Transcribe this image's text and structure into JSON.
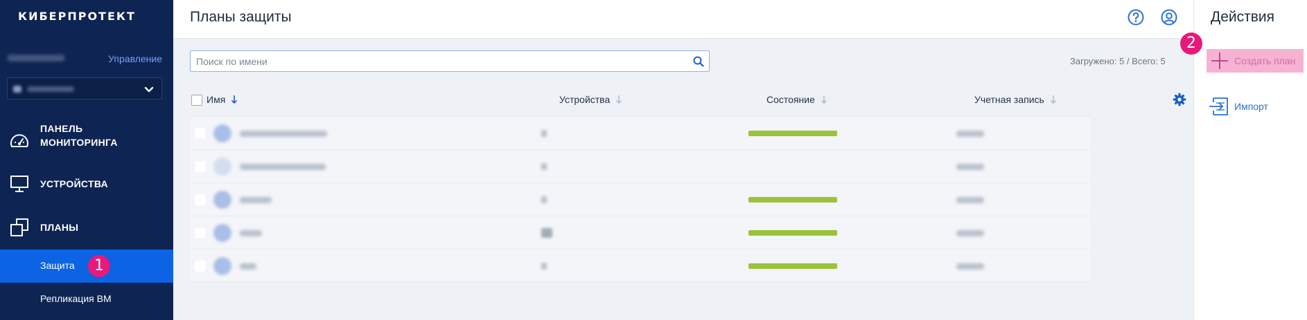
{
  "app": {
    "logo": "КИБЕРПРОТЕКТ"
  },
  "sidebar": {
    "manage_label": "Управление",
    "nav": [
      {
        "label": "ПАНЕЛЬ МОНИТОРИНГА",
        "icon": "dashboard-gauge-icon"
      },
      {
        "label": "УСТРОЙСТВА",
        "icon": "monitor-icon"
      },
      {
        "label": "ПЛАНЫ",
        "icon": "plans-stack-icon"
      }
    ],
    "sub": [
      {
        "label": "Защита",
        "active": true
      },
      {
        "label": "Репликация ВМ",
        "active": false
      }
    ],
    "badge_1": "1"
  },
  "header": {
    "title": "Планы защиты",
    "help_icon": "help-icon",
    "account_icon": "account-icon"
  },
  "search": {
    "placeholder": "Поиск по имени",
    "value": ""
  },
  "loaded_text": "Загружено: 5 / Всего: 5",
  "table": {
    "columns": [
      "Имя",
      "Устройства",
      "Состояние",
      "Учетная запись"
    ],
    "rows": [
      {
        "state": "ok"
      },
      {
        "state": "none"
      },
      {
        "state": "ok"
      },
      {
        "state": "ok"
      },
      {
        "state": "ok"
      }
    ]
  },
  "actions": {
    "title": "Действия",
    "create_label": "Создать план",
    "import_label": "Импорт",
    "badge_2": "2"
  },
  "colors": {
    "sidebar_bg": "#0e2452",
    "accent": "#0c63e4",
    "badge": "#e8197a",
    "status_ok": "#9bc23b",
    "create_highlight": "#f6b2d3"
  }
}
